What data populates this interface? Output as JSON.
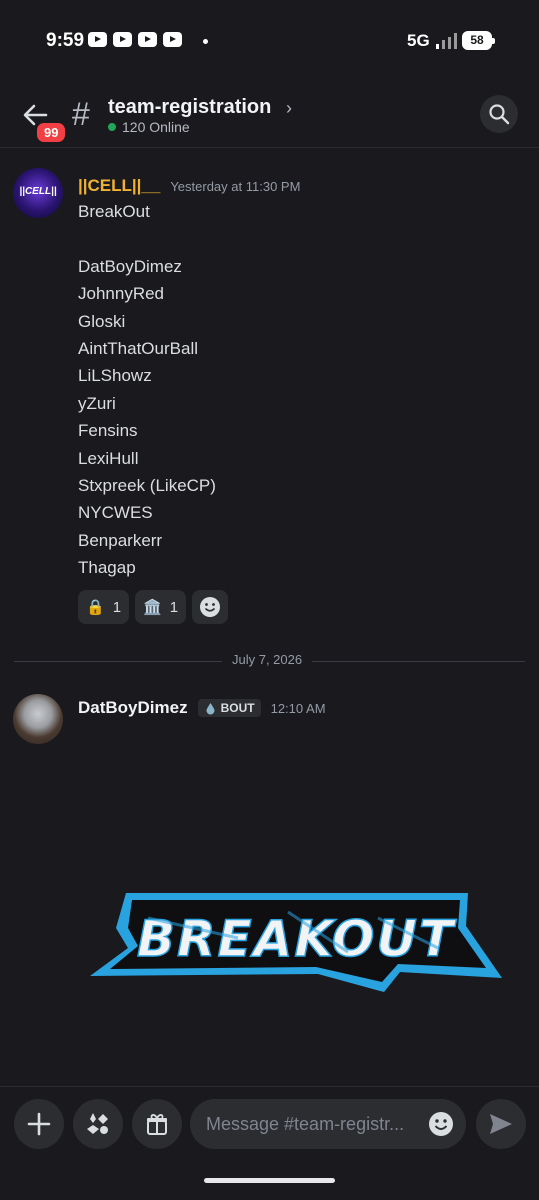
{
  "status_bar": {
    "time": "9:59",
    "network": "5G",
    "battery": "58"
  },
  "header": {
    "back_badge": "99",
    "channel_name": "team-registration",
    "online": "120 Online"
  },
  "messages": [
    {
      "author": "||CELL||__",
      "avatar_text": "||CELL||",
      "timestamp": "Yesterday at 11:30 PM",
      "lines": [
        "BreakOut",
        "",
        "DatBoyDimez",
        "JohnnyRed",
        "Gloski",
        "AintThatOurBall",
        "LiLShowz",
        "yZuri",
        "Fensins",
        "LexiHull",
        "Stxpreek (LikeCP)",
        "NYCWES",
        "Benparkerr",
        "Thagap"
      ],
      "reactions": [
        {
          "emoji": "🔒",
          "icon": "lock-emoji",
          "count": "1"
        },
        {
          "emoji": "🏛️",
          "icon": "bank-emoji",
          "count": "1"
        }
      ]
    },
    {
      "author": "DatBoyDimez",
      "tag": "BOUT",
      "timestamp": "12:10 AM",
      "image_text": "BREAKOUT"
    }
  ],
  "date_divider": "July 7, 2026",
  "composer": {
    "placeholder": "Message #team-registr..."
  },
  "colors": {
    "accent_yellow": "#f0b232",
    "online_green": "#23a55a",
    "badge_red": "#f23f43",
    "logo_blue": "#29a3e0"
  }
}
